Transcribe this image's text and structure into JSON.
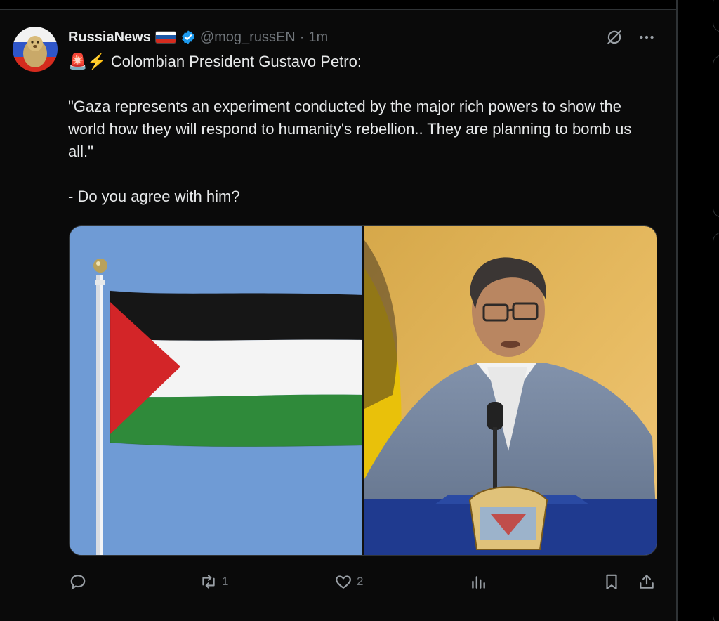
{
  "tweet": {
    "display_name": "RussiaNews",
    "handle": "@mog_russEN",
    "dot": "·",
    "time": "1m",
    "text_line1": "🚨⚡ Colombian President Gustavo Petro:",
    "quote": "\"Gaza represents an experiment conducted by the major rich powers to show the world how they will respond to humanity's rebellion.. They are planning to bomb us all.\"",
    "question": "- Do you agree with him?",
    "reply_count": "",
    "retweet_count": "1",
    "like_count": "2",
    "views_count": ""
  },
  "icons": {
    "verified": "verified-badge-icon",
    "grok": "grok-icon",
    "more": "more-icon",
    "reply": "reply-icon",
    "retweet": "retweet-icon",
    "like": "heart-icon",
    "views": "views-icon",
    "bookmark": "bookmark-icon",
    "share": "share-icon"
  },
  "colors": {
    "background": "#0a0a0a",
    "text": "#e7e9ea",
    "muted": "#71767b",
    "verified": "#1d9bf0"
  }
}
